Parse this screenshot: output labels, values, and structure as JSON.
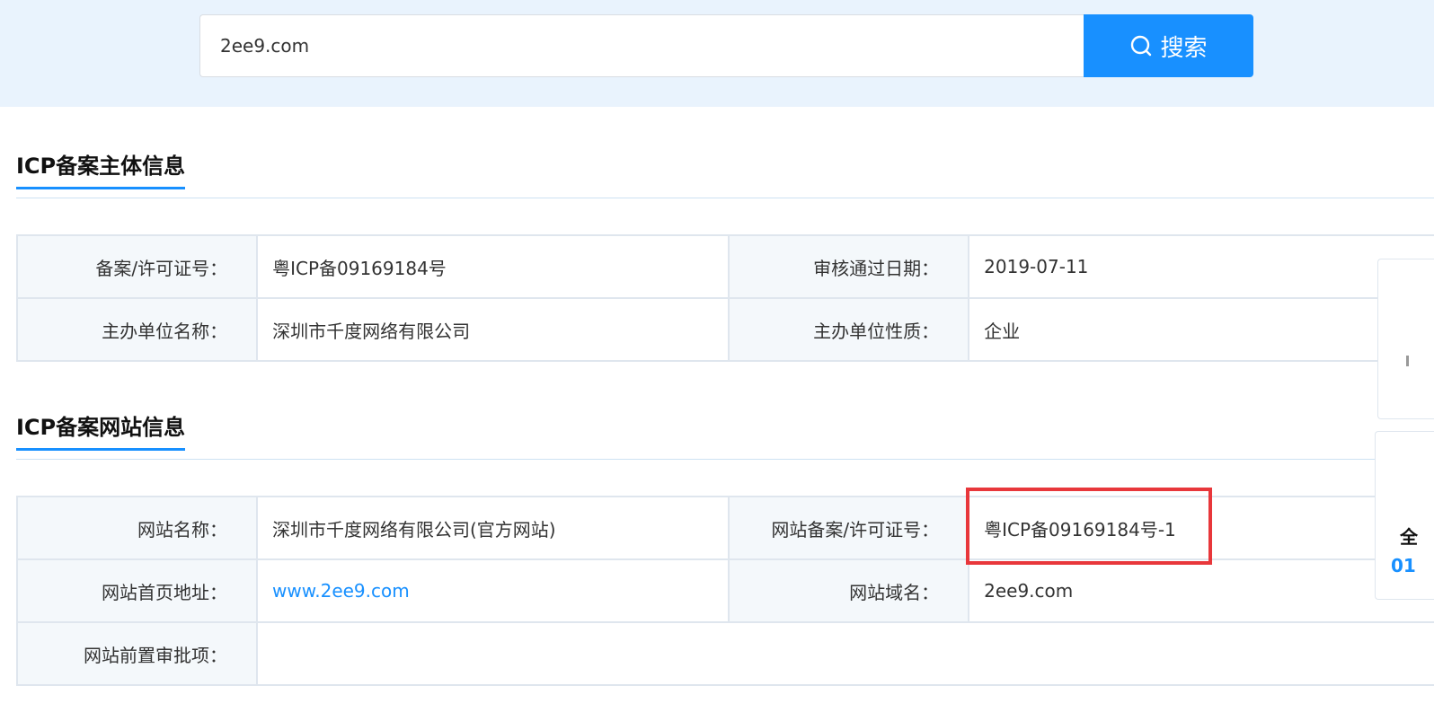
{
  "search": {
    "value": "2ee9.com",
    "button_label": "搜索",
    "button_color": "#1890ff"
  },
  "subject_section": {
    "title": "ICP备案主体信息",
    "rows": [
      [
        {
          "label": "备案/许可证号：",
          "value": "粤ICP备09169184号"
        },
        {
          "label": "审核通过日期：",
          "value": "2019-07-11"
        }
      ],
      [
        {
          "label": "主办单位名称：",
          "value": "深圳市千度网络有限公司"
        },
        {
          "label": "主办单位性质：",
          "value": "企业"
        }
      ]
    ]
  },
  "website_section": {
    "title": "ICP备案网站信息",
    "site_name_label": "网站名称：",
    "site_name": "深圳市千度网络有限公司(官方网站)",
    "license_label": "网站备案/许可证号：",
    "license": "粤ICP备09169184号-1",
    "homepage_label": "网站首页地址：",
    "homepage": "www.2ee9.com",
    "domain_label": "网站域名：",
    "domain": "2ee9.com",
    "pre_approval_label": "网站前置审批项：",
    "pre_approval": ""
  },
  "highlight_color": "#e8373b",
  "side_panel": {
    "text1": "全",
    "text2": "01"
  }
}
